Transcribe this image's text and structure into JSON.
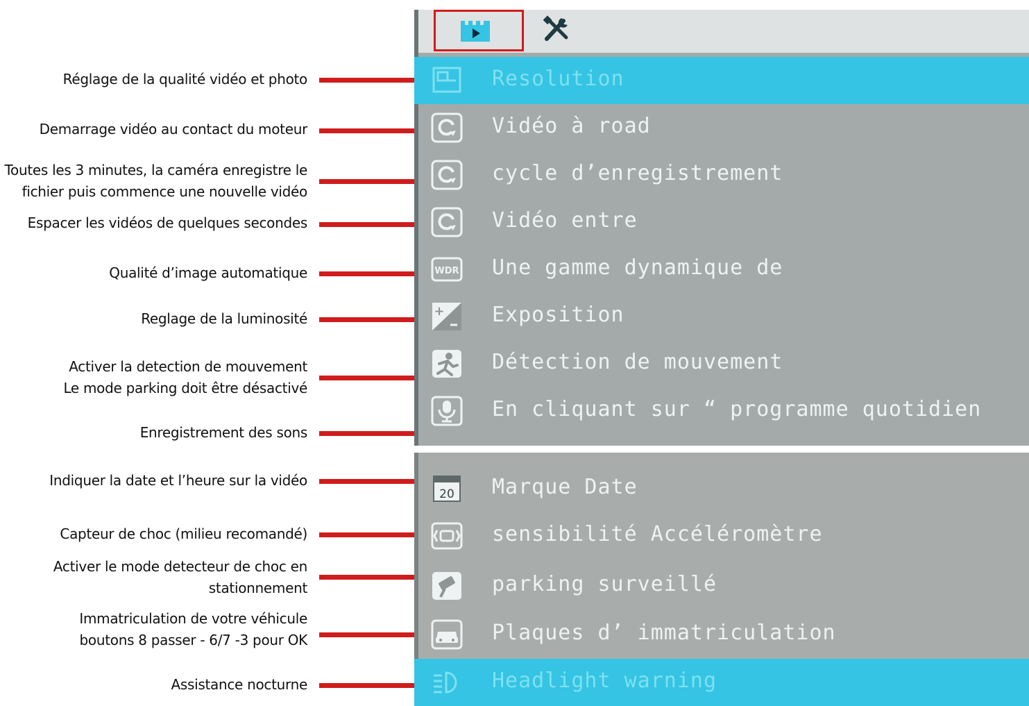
{
  "annotations": [
    {
      "lines": [
        "Réglage de la qualité vidéo et photo"
      ]
    },
    {
      "lines": [
        "Demarrage vidéo au contact du moteur"
      ]
    },
    {
      "lines": [
        "Toutes les 3 minutes, la caméra enregistre le",
        "fichier puis commence une nouvelle vidéo"
      ]
    },
    {
      "lines": [
        "Espacer les vidéos de quelques secondes"
      ]
    },
    {
      "lines": [
        "Qualité d’image automatique"
      ]
    },
    {
      "lines": [
        "Reglage de la luminosité"
      ]
    },
    {
      "lines": [
        "Activer la detection de mouvement",
        "Le mode parking doit être désactivé"
      ]
    },
    {
      "lines": [
        "Enregistrement des sons"
      ]
    },
    {
      "lines": [
        "Indiquer la date et l’heure sur la vidéo"
      ]
    },
    {
      "lines": [
        "Capteur de choc (milieu recomandé)"
      ]
    },
    {
      "lines": [
        "Activer le mode detecteur de choc en",
        "stationnement"
      ]
    },
    {
      "lines": [
        "Immatriculation de votre véhicule",
        "boutons 8 passer - 6/7 -3 pour OK"
      ]
    },
    {
      "lines": [
        "Assistance nocturne"
      ]
    }
  ],
  "tabs": {
    "video_icon": "video-icon",
    "settings_icon": "tools-icon",
    "active": "video"
  },
  "menu_top": [
    {
      "label": "Resolution",
      "icon": "resolution-icon",
      "selected": true
    },
    {
      "label": "Vidéo à road",
      "icon": "loop-icon",
      "selected": false
    },
    {
      "label": "cycle d’enregistrement",
      "icon": "loop-icon",
      "selected": false
    },
    {
      "label": "Vidéo entre",
      "icon": "loop-icon",
      "selected": false
    },
    {
      "label": "Une gamme dynamique de",
      "icon": "wdr-icon",
      "selected": false
    },
    {
      "label": "Exposition",
      "icon": "exposure-icon",
      "selected": false
    },
    {
      "label": "Détection de mouvement",
      "icon": "motion-icon",
      "selected": false
    },
    {
      "label": "En cliquant sur “ programme quotidien",
      "icon": "microphone-icon",
      "selected": false
    }
  ],
  "menu_bottom": [
    {
      "label": "Marque Date",
      "icon": "calendar-icon",
      "calendar_text": "20",
      "selected": false
    },
    {
      "label": "sensibilité Accéléromètre",
      "icon": "gsensor-icon",
      "selected": false
    },
    {
      "label": "parking surveillé",
      "icon": "parking-camera-icon",
      "selected": false
    },
    {
      "label": "Plaques d’ immatriculation",
      "icon": "car-icon",
      "selected": false
    },
    {
      "label": "Headlight warning",
      "icon": "headlight-icon",
      "selected": true
    }
  ],
  "colors": {
    "accent_red": "#d01c1c",
    "menu_bg": "#a4aaaa",
    "highlight": "#35c4e3",
    "menu_text": "#eef2f2"
  }
}
